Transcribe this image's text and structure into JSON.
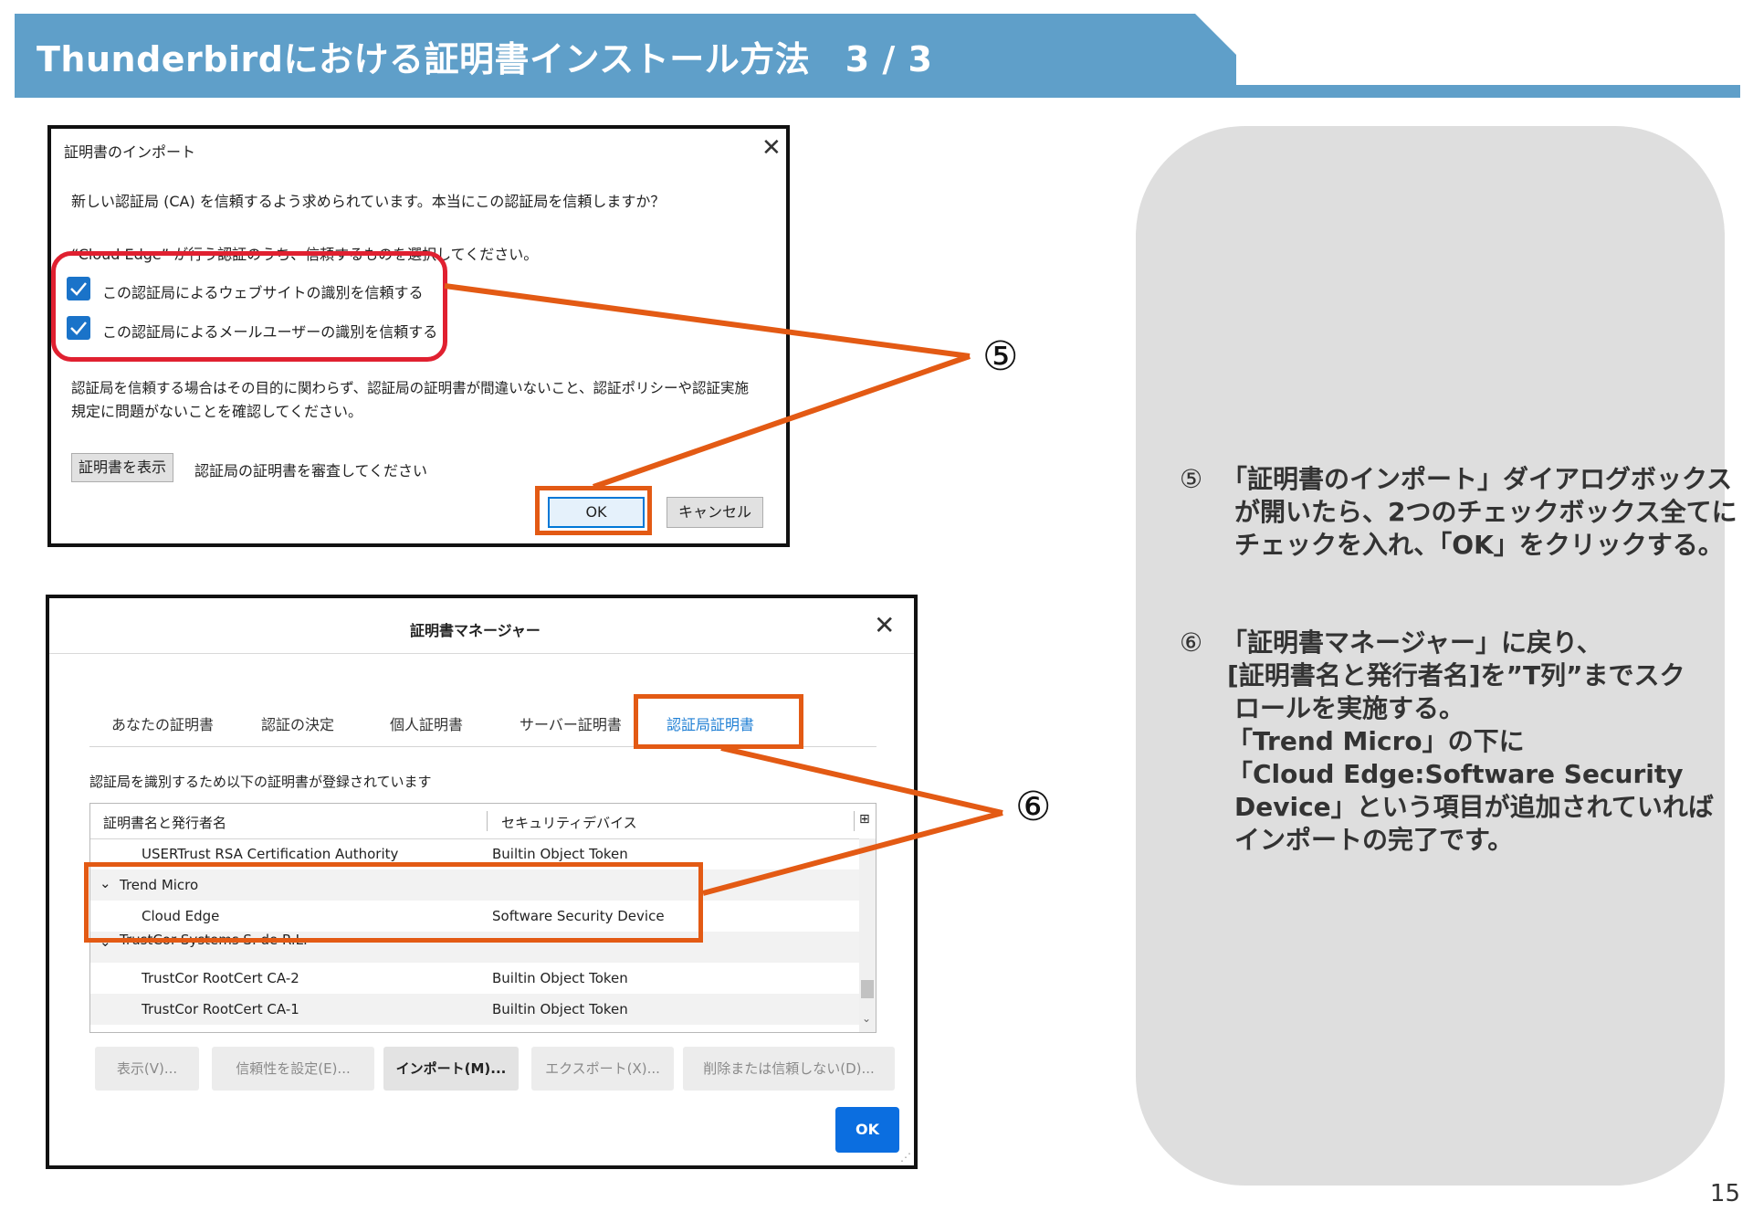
{
  "slide": {
    "title": "Thunderbirdにおける証明書インストール方法　3 / 3",
    "page_number": "15"
  },
  "colors": {
    "banner": "#5f9fc9",
    "highlight_red": "#e02030",
    "highlight_orange": "#e35a14",
    "accent_blue": "#1f7fd4"
  },
  "import_dialog": {
    "title": "証明書のインポート",
    "prompt": "新しい認証局 (CA) を信頼するよう求められています。本当にこの認証局を信頼しますか？",
    "select_prompt": "“Cloud Edge” が行う認証のうち、信頼するものを選択してください。",
    "checkboxes": [
      {
        "label": "この認証局によるウェブサイトの識別を信頼する",
        "checked": true
      },
      {
        "label": "この認証局によるメールユーザーの識別を信頼する",
        "checked": true
      }
    ],
    "notice_line1": "認証局を信頼する場合はその目的に関わらず、認証局の証明書が間違いないこと、認証ポリシーや認証実施",
    "notice_line2": "規定に問題がないことを確認してください。",
    "view_button": "証明書を表示",
    "view_hint": "認証局の証明書を審査してください",
    "ok_button": "OK",
    "cancel_button": "キャンセル"
  },
  "manager_dialog": {
    "title": "証明書マネージャー",
    "tabs": [
      "あなたの証明書",
      "認証の決定",
      "個人証明書",
      "サーバー証明書",
      "認証局証明書"
    ],
    "active_tab": "認証局証明書",
    "description": "認証局を識別するため以下の証明書が登録されています",
    "columns": [
      "証明書名と発行者名",
      "セキュリティデバイス"
    ],
    "rows": [
      {
        "name": "USERTrust RSA Certification Authority",
        "device": "Builtin Object Token",
        "group": false
      },
      {
        "name": "Trend Micro",
        "device": "",
        "group": true
      },
      {
        "name": "Cloud Edge",
        "device": "Software Security Device",
        "group": false
      },
      {
        "name": "TrustCor Systems S. de R.L.",
        "device": "",
        "group": true
      },
      {
        "name": "TrustCor RootCert CA-2",
        "device": "Builtin Object Token",
        "group": false
      },
      {
        "name": "TrustCor RootCert CA-1",
        "device": "Builtin Object Token",
        "group": false
      }
    ],
    "buttons": {
      "view": "表示(V)...",
      "trust": "信頼性を設定(E)...",
      "import": "インポート(M)...",
      "export": "エクスポート(X)...",
      "delete": "削除または信頼しない(D)..."
    },
    "ok_button": "OK"
  },
  "callouts": {
    "five": "⑤",
    "six": "⑥"
  },
  "instructions": {
    "step5": {
      "marker": "⑤",
      "lines": [
        "「証明書のインポート」ダイアログボックス",
        "が開いたら、2つのチェックボックス全てに",
        "チェックを入れ、「OK」をクリックする。"
      ]
    },
    "step6": {
      "marker": "⑥",
      "lines": [
        "「証明書マネージャー」に戻り、",
        "[証明書名と発行者名]を”T列”までスク",
        "ロールを実施する。",
        "「Trend Micro」の下に",
        "「Cloud Edge:Software Security",
        "Device」という項目が追加されていれば",
        "インポートの完了です。"
      ]
    }
  }
}
